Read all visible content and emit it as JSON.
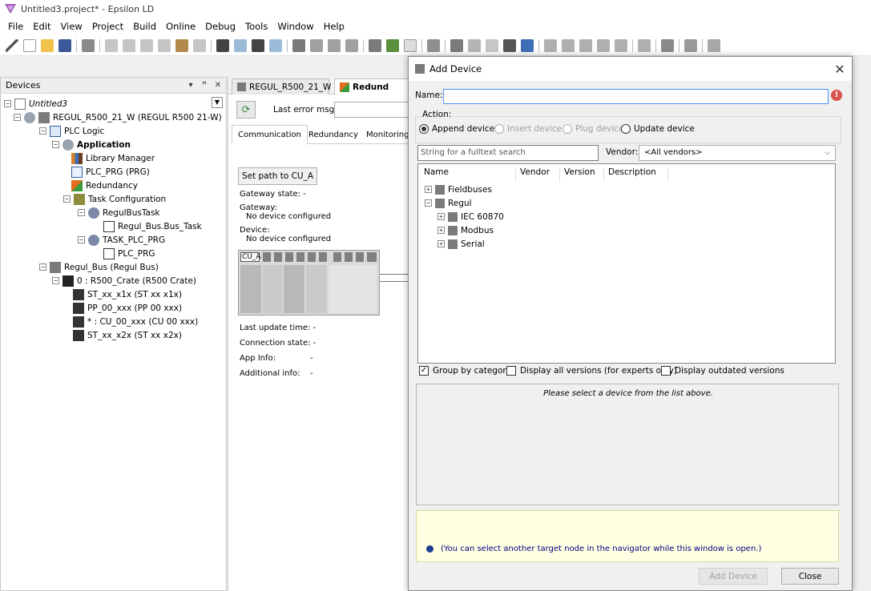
{
  "window": {
    "title": "Untitled3.project* - Epsilon LD"
  },
  "menu": [
    "File",
    "Edit",
    "View",
    "Project",
    "Build",
    "Online",
    "Debug",
    "Tools",
    "Window",
    "Help"
  ],
  "devices_panel": {
    "title": "Devices",
    "header_buttons": [
      "▾",
      "ꟸ",
      "✕"
    ],
    "tree": [
      {
        "label": "Untitled3",
        "icon": "project-icon",
        "italic": true
      },
      {
        "label": "REGUL_R500_21_W (REGUL R500 21-W)",
        "icon": "plc-device-icon"
      },
      {
        "label": "PLC Logic",
        "icon": "plc-logic-icon"
      },
      {
        "label": "Application",
        "icon": "application-icon",
        "bold": true
      },
      {
        "label": "Library Manager",
        "icon": "library-manager-icon"
      },
      {
        "label": "PLC_PRG (PRG)",
        "icon": "program-icon"
      },
      {
        "label": "Redundancy",
        "icon": "redundancy-icon"
      },
      {
        "label": "Task Configuration",
        "icon": "task-configuration-icon"
      },
      {
        "label": "RegulBusTask",
        "icon": "task-icon"
      },
      {
        "label": "Regul_Bus.Bus_Task",
        "icon": "task-call-icon"
      },
      {
        "label": "TASK_PLC_PRG",
        "icon": "task-icon"
      },
      {
        "label": "PLC_PRG",
        "icon": "task-call-icon"
      },
      {
        "label": "Regul_Bus (Regul Bus)",
        "icon": "bus-icon"
      },
      {
        "label": "0 : R500_Crate (R500 Crate)",
        "icon": "crate-icon"
      },
      {
        "label": "ST_xx_x1x (ST xx x1x)",
        "icon": "module-icon"
      },
      {
        "label": "PP_00_xxx (PP 00 xxx)",
        "icon": "module-icon"
      },
      {
        "label": "* : CU_00_xxx (CU 00 xxx)",
        "icon": "module-icon"
      },
      {
        "label": "ST_xx_x2x (ST xx x2x)",
        "icon": "module-icon"
      }
    ]
  },
  "editor": {
    "tabs": [
      "REGUL_R500_21_W",
      "Redund"
    ],
    "last_error_label": "Last error msg:",
    "subtabs": [
      "Communication",
      "Redundancy",
      "Monitoring"
    ],
    "set_path_button": "Set path to CU_A",
    "gateway_state": "Gateway state:  -",
    "gateway_label": "Gateway:",
    "gateway_value": "No device configured",
    "device_label": "Device:",
    "device_value": "No device configured",
    "crate_label": "CU_A",
    "last_update": "Last update time:  -",
    "connection_state": "Connection state:  -",
    "app_info_label": "App Info:",
    "app_info_value": "-",
    "additional_info_label": "Additional info:",
    "additional_info_value": "-"
  },
  "dialog": {
    "title": "Add Device",
    "name_label": "Name:",
    "name_value": "",
    "action_label": "Action:",
    "actions": [
      {
        "label": "Append device",
        "selected": true,
        "enabled": true
      },
      {
        "label": "Insert device",
        "selected": false,
        "enabled": false
      },
      {
        "label": "Plug device",
        "selected": false,
        "enabled": false
      },
      {
        "label": "Update device",
        "selected": false,
        "enabled": true
      }
    ],
    "search_placeholder": "String for a fulltext search",
    "vendor_label": "Vendor:",
    "vendor_value": "<All vendors>",
    "columns": [
      "Name",
      "Vendor",
      "Version",
      "Description"
    ],
    "items": [
      {
        "label": "Fieldbuses",
        "level": 0,
        "expander": "+"
      },
      {
        "label": "Regul",
        "level": 0,
        "expander": "−"
      },
      {
        "label": "IEC 60870",
        "level": 1,
        "expander": "+"
      },
      {
        "label": "Modbus",
        "level": 1,
        "expander": "+"
      },
      {
        "label": "Serial",
        "level": 1,
        "expander": "+"
      }
    ],
    "checkboxes": [
      {
        "label": "Group by category",
        "checked": true
      },
      {
        "label": "Display all versions (for experts only)",
        "checked": false
      },
      {
        "label": "Display outdated versions",
        "checked": false
      }
    ],
    "description_hint": "Please select a device from the list above.",
    "info_text": "(You can select another target node in the navigator while this window is open.)",
    "add_button": "Add Device",
    "close_button": "Close"
  }
}
